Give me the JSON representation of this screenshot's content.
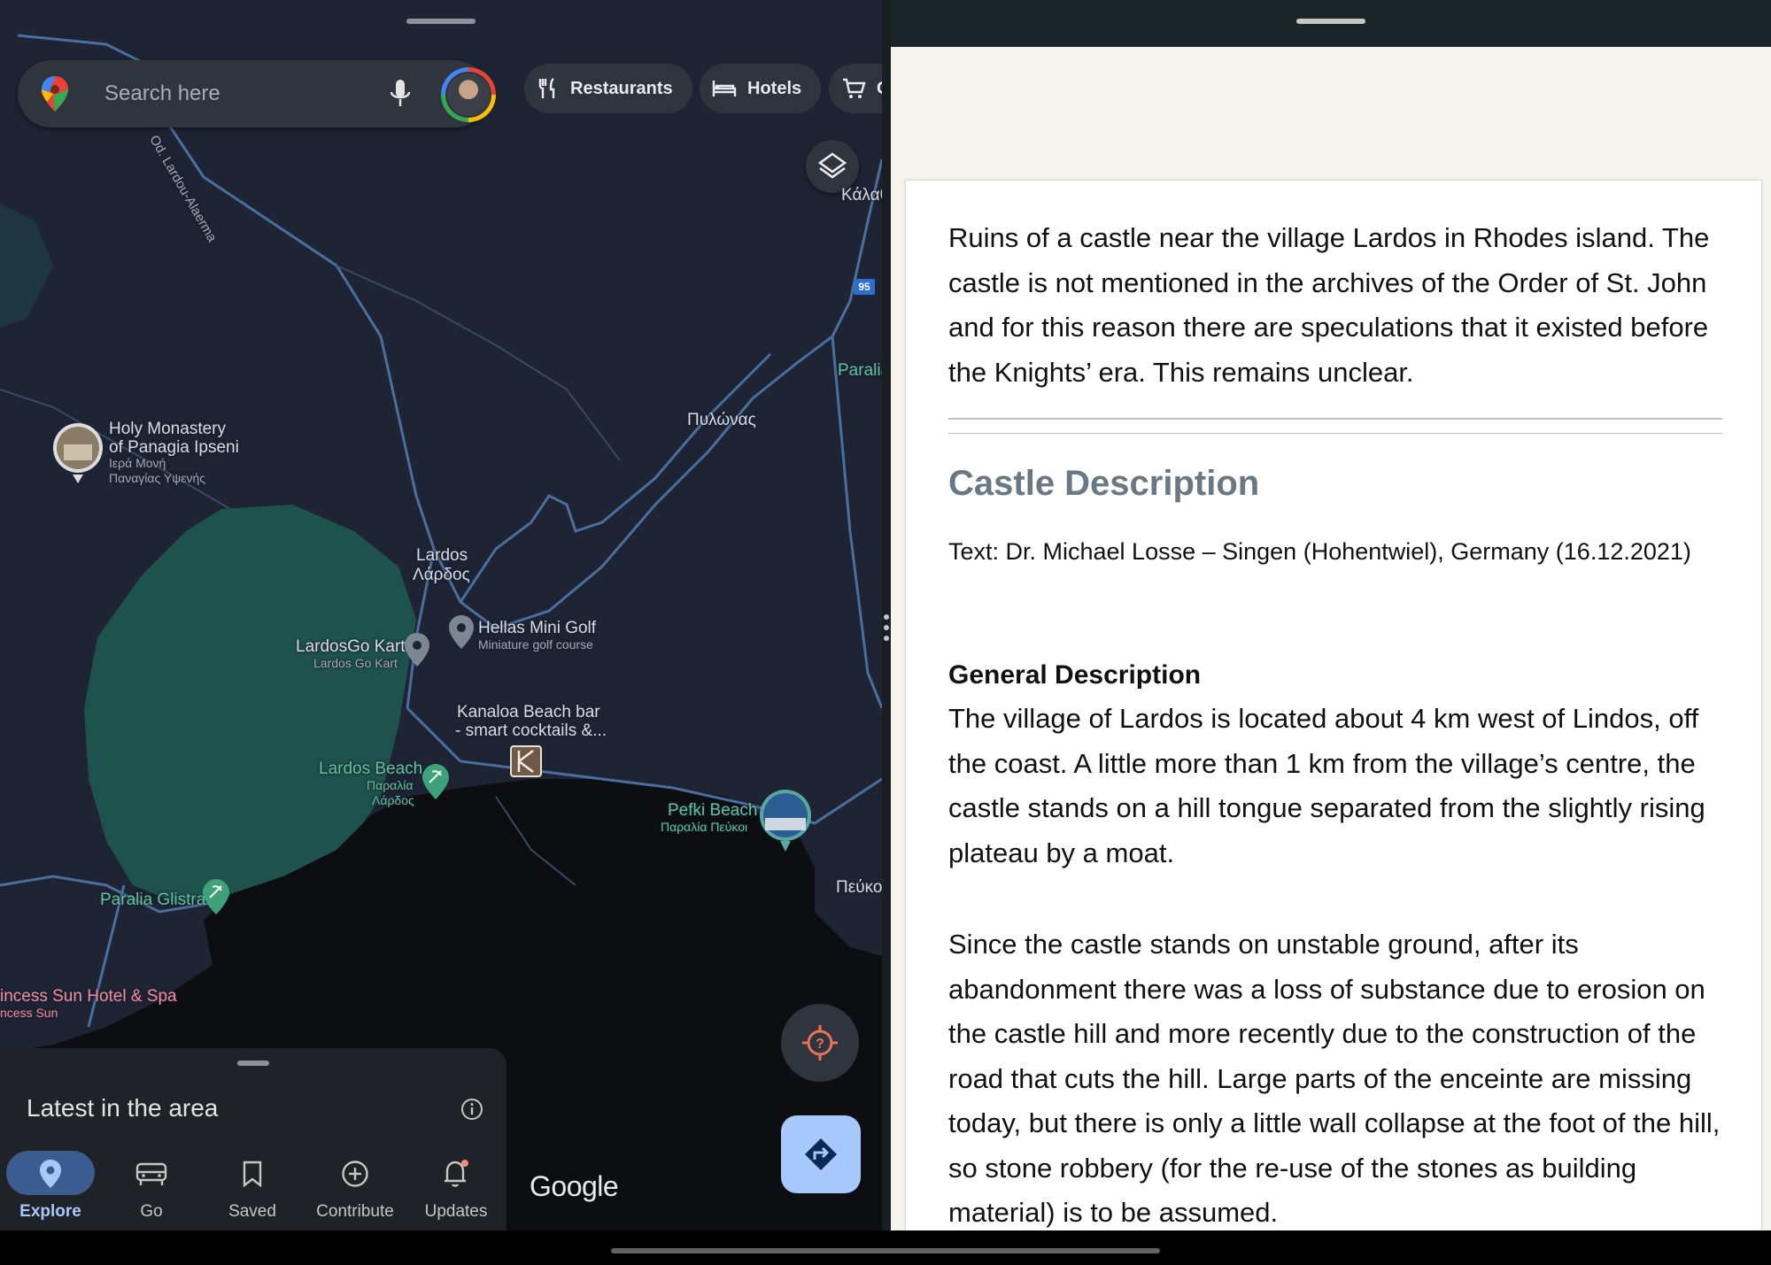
{
  "map": {
    "search_placeholder": "Search here",
    "chips": [
      {
        "label": "Restaurants",
        "icon": "fork-knife-icon"
      },
      {
        "label": "Hotels",
        "icon": "bed-icon"
      },
      {
        "label": "G",
        "icon": "cart-icon"
      }
    ],
    "labels": {
      "kalathos": "Κάλαθ",
      "road_95": "95",
      "paralia_right": "Paralia",
      "pylonas": "Πυλώνας",
      "monastery_1": "Holy Monastery",
      "monastery_2": "of Panagia Ipseni",
      "monastery_sub1": "Ιερά Μονή",
      "monastery_sub2": "Παναγίας Υψενής",
      "lardos": "Lardos",
      "lardos_gr": "Λάρδος",
      "lardosgo": "LardosGo Kart",
      "lardosgo_sub": "Lardos Go Kart",
      "hellas": "Hellas Mini Golf",
      "hellas_sub": "Miniature golf course",
      "kanaloa_1": "Kanaloa Beach bar",
      "kanaloa_2": "- smart cocktails &...",
      "lardos_beach": "Lardos Beach",
      "lardos_beach_sub1": "Παραλία",
      "lardos_beach_sub2": "Λάρδος",
      "pefki_beach": "Pefki Beach",
      "pefki_beach_sub": "Παραλία Πεύκοι",
      "pefko": "Πεύκο",
      "glistra": "Paralia Glistra",
      "princess": "incess Sun Hotel & Spa",
      "princess_sub": "ncess Sun",
      "road_name": "Od. Lardou-Alaerma"
    },
    "google_logo": "Google"
  },
  "bottom_sheet": {
    "title": "Latest in the area",
    "nav": [
      {
        "label": "Explore",
        "icon": "location-pin-icon",
        "active": true
      },
      {
        "label": "Go",
        "icon": "car-icon",
        "active": false
      },
      {
        "label": "Saved",
        "icon": "bookmark-icon",
        "active": false
      },
      {
        "label": "Contribute",
        "icon": "plus-circle-icon",
        "active": false
      },
      {
        "label": "Updates",
        "icon": "bell-icon",
        "active": false
      }
    ]
  },
  "article": {
    "intro": "Ruins of a castle near the village Lardos in Rhodes island. The castle is not mentioned in the archives of the Order of St. John and for this reason there are speculations that it existed before the Knights’ era. This remains unclear.",
    "heading": "Castle Description",
    "credit": "Text: Dr. Michael Losse – Singen (Hohentwiel), Germany (16.12.2021)",
    "general_heading": "General Description",
    "paragraph1": "The village of Lardos is located about 4 km west of Lindos, off the coast. A little more than 1 km from the village’s centre, the castle stands on a hill tongue separated from the slightly rising plateau by a moat.",
    "paragraph2": "Since the castle stands on unstable ground, after its abandonment there was a loss of substance due to erosion on the castle hill and more recently due to the construction of the road that cuts the hill. Large parts of the enceinte are missing today, but there is only a little wall collapse at the foot of the hill, so stone robbery (for the re-use of the stones as building material) is to be assumed."
  },
  "colors": {
    "map_land": "#1e2433",
    "map_park": "#1f5c52",
    "map_sea": "#0c0e12",
    "map_road": "#4a6f9e",
    "accent_blue": "#a8c7fa"
  }
}
